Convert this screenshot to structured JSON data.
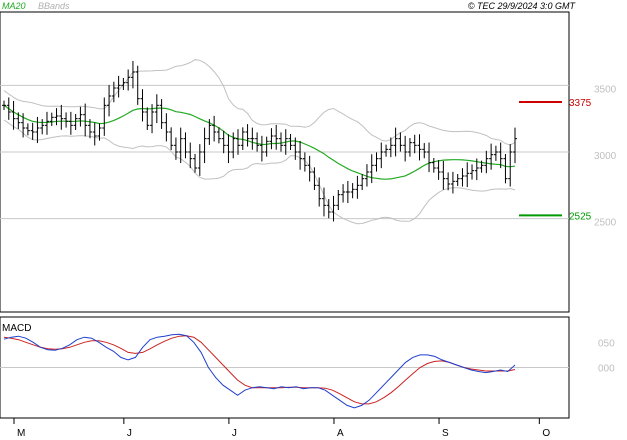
{
  "header": {
    "ma_label": "MA20",
    "bands_label": "BBands",
    "copyright": "© TEC 29/9/2024 3:0 GMT"
  },
  "macd": {
    "label": "MACD",
    "y_ticks": [
      "050",
      "000"
    ],
    "tick_values": [
      50,
      0
    ],
    "ylim": [
      -100,
      100
    ]
  },
  "price_axis": {
    "ticks": [
      "3500",
      "3000",
      "2500"
    ],
    "tick_values": [
      3500,
      3000,
      2500
    ],
    "ylim": [
      1800,
      4050
    ]
  },
  "x_axis": {
    "months": [
      "M",
      "J",
      "J",
      "A",
      "S",
      "O"
    ],
    "month_index": [
      0,
      23,
      45,
      67,
      89,
      110
    ]
  },
  "levels": [
    {
      "label": "3375",
      "value": 3375,
      "color": "#cc0000"
    },
    {
      "label": "2525",
      "value": 2525,
      "color": "#009900"
    }
  ],
  "colors": {
    "ma": "#22aa22",
    "bands": "#c0c0c0",
    "bars": "#000000",
    "macd_line": "#1f3fcc",
    "signal_line": "#cc2222",
    "grid": "#c8c8c8"
  },
  "chart_data": [
    {
      "type": "ohlc",
      "title": "",
      "series": [
        {
          "name": "MA20"
        },
        {
          "name": "BBands"
        }
      ],
      "ylim": [
        1800,
        4050
      ],
      "support_resistance": [
        3375,
        2525
      ],
      "closes": [
        3350,
        3300,
        3250,
        3220,
        3180,
        3160,
        3150,
        3180,
        3200,
        3230,
        3260,
        3270,
        3250,
        3230,
        3200,
        3250,
        3280,
        3200,
        3150,
        3120,
        3180,
        3350,
        3420,
        3480,
        3500,
        3520,
        3560,
        3600,
        3400,
        3300,
        3200,
        3300,
        3350,
        3220,
        3150,
        3050,
        3000,
        3100,
        3000,
        2950,
        2880,
        3000,
        3100,
        3200,
        3150,
        3100,
        3050,
        3000,
        3100,
        3050,
        3150,
        3100,
        3100,
        3050,
        3000,
        3080,
        3120,
        3100,
        3050,
        3100,
        3050,
        3000,
        2950,
        2900,
        2850,
        2750,
        2650,
        2600,
        2550,
        2600,
        2680,
        2700,
        2700,
        2720,
        2750,
        2800,
        2850,
        2900,
        2950,
        3000,
        3020,
        3050,
        3100,
        3050,
        3000,
        3070,
        3050,
        3020,
        3000,
        2920,
        2880,
        2850,
        2800,
        2760,
        2780,
        2800,
        2820,
        2840,
        2860,
        2880,
        2900,
        2950,
        2980,
        3000,
        2950,
        2800,
        3000,
        3100
      ]
    },
    {
      "type": "line",
      "title": "MACD",
      "series": [
        {
          "name": "MACD"
        },
        {
          "name": "Signal"
        }
      ],
      "ylim": [
        -100,
        100
      ],
      "macd": [
        56,
        60,
        62,
        58,
        50,
        40,
        35,
        34,
        38,
        45,
        55,
        60,
        58,
        50,
        40,
        32,
        20,
        15,
        20,
        40,
        55,
        60,
        62,
        65,
        66,
        63,
        50,
        30,
        0,
        -20,
        -35,
        -45,
        -55,
        -45,
        -40,
        -38,
        -40,
        -42,
        -38,
        -40,
        -38,
        -42,
        -40,
        -40,
        -45,
        -55,
        -65,
        -75,
        -80,
        -75,
        -65,
        -50,
        -35,
        -20,
        -5,
        10,
        20,
        25,
        25,
        22,
        15,
        10,
        5,
        0,
        -5,
        -8,
        -10,
        -8,
        -5,
        -8,
        5
      ],
      "signal": [
        60,
        58,
        55,
        50,
        45,
        40,
        37,
        36,
        37,
        40,
        45,
        50,
        53,
        53,
        50,
        45,
        38,
        30,
        28,
        30,
        37,
        45,
        52,
        58,
        62,
        63,
        60,
        50,
        35,
        20,
        5,
        -10,
        -25,
        -35,
        -40,
        -40,
        -40,
        -40,
        -40,
        -39,
        -39,
        -40,
        -40,
        -40,
        -41,
        -45,
        -52,
        -60,
        -68,
        -72,
        -72,
        -68,
        -60,
        -50,
        -38,
        -25,
        -12,
        0,
        8,
        12,
        13,
        10,
        5,
        0,
        -3,
        -5,
        -7,
        -7,
        -7,
        -7,
        -4
      ]
    }
  ]
}
